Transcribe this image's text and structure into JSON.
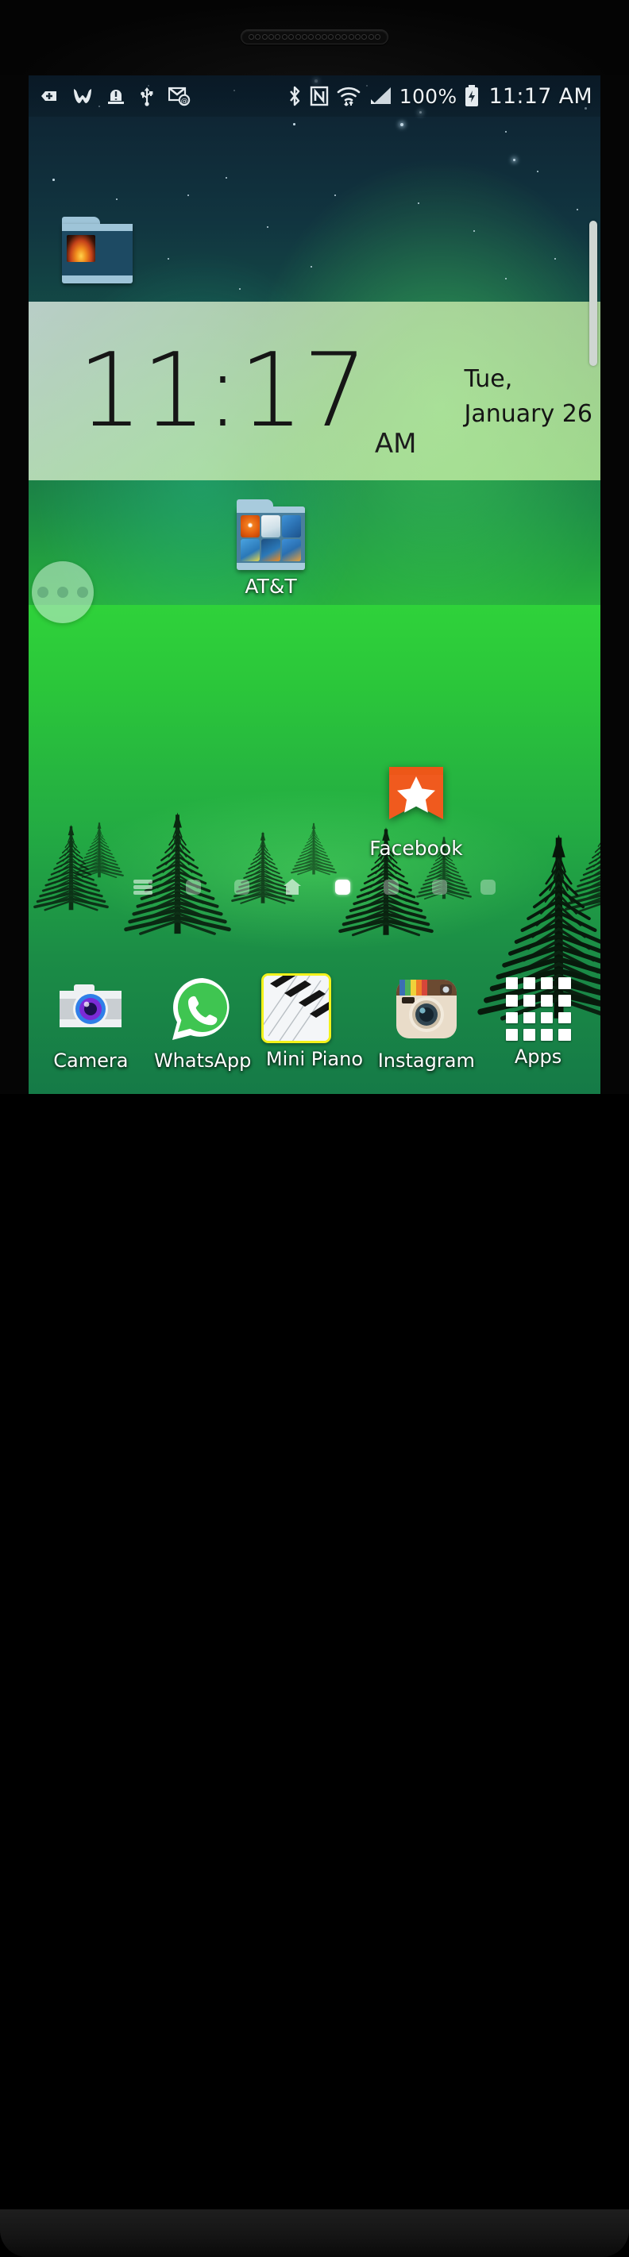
{
  "device": {
    "name": "android-phone",
    "earpiece_holes": 20
  },
  "status_bar": {
    "left_icons": [
      {
        "name": "medical-plus-icon",
        "glyph": "+"
      },
      {
        "name": "w-app-icon",
        "glyph": "W"
      },
      {
        "name": "alert-warning-icon",
        "glyph": "!"
      },
      {
        "name": "usb-icon",
        "glyph": "USB"
      },
      {
        "name": "email-at-icon",
        "glyph": "@"
      }
    ],
    "right_icons": [
      {
        "name": "bluetooth-icon",
        "glyph": "BT"
      },
      {
        "name": "nfc-icon",
        "glyph": "N"
      },
      {
        "name": "wifi-icon",
        "glyph": "WiFi"
      },
      {
        "name": "cellular-signal-icon",
        "glyph": "signal"
      },
      {
        "name": "battery-charging-icon",
        "glyph": "battery"
      }
    ],
    "battery_percent": "100%",
    "clock": "11:17 AM"
  },
  "clock_widget": {
    "time": "11:17",
    "ampm": "AM",
    "day": "Tue,",
    "date": "January 26"
  },
  "dark_folder": {
    "name": "music-folder",
    "label": "",
    "item_count": 1,
    "items": [
      {
        "name": "fire-album-art",
        "colors": [
          "#1a0d06",
          "#e8731a",
          "#f2b03c"
        ]
      }
    ]
  },
  "home_icons": [
    {
      "name": "att-folder",
      "label": "AT&T",
      "type": "folder",
      "items": [
        {
          "name": "att-globe-icon",
          "color": "#f06010"
        },
        {
          "name": "att-locker-icon",
          "color": "#e8eef2"
        },
        {
          "name": "att-navigator-icon",
          "color": "#2d7fc4"
        },
        {
          "name": "att-ready2go-icon",
          "color": "#2a6fb0"
        },
        {
          "name": "att-smart-wifi-icon",
          "color": "#1b4f80"
        },
        {
          "name": "att-mobile-icon",
          "color": "#2d85d8"
        }
      ]
    },
    {
      "name": "facebook-shortcut",
      "label": "Facebook",
      "type": "shortcut",
      "icon": "orange-ribbon-star-icon",
      "colors": {
        "ribbon": "#f05a1e",
        "star": "#ffffff"
      }
    }
  ],
  "page_indicator": {
    "total_pages": 7,
    "active_index": 4,
    "leading_icon": "list-hamburger-icon",
    "home_index": 3,
    "home_icon": "home-icon"
  },
  "dock": {
    "items": [
      {
        "name": "dock-camera",
        "label": "Camera",
        "icon": "camera-icon",
        "colors": {
          "body": "#d9dde0",
          "lens": "#5b2bd6",
          "ring": "#2f7fe8"
        }
      },
      {
        "name": "dock-whatsapp",
        "label": "WhatsApp",
        "icon": "whatsapp-icon",
        "colors": {
          "bubble": "#3fc551",
          "phone": "#ffffff"
        }
      },
      {
        "name": "dock-mini-piano",
        "label": "Mini Piano",
        "icon": "piano-keys-icon",
        "colors": {
          "border": "#f2f21a",
          "white_key": "#ffffff",
          "black_key": "#111111"
        }
      },
      {
        "name": "dock-instagram",
        "label": "Instagram",
        "icon": "instagram-retro-camera-icon",
        "colors": {
          "body": "#e9dcc9",
          "top": "#6b4a31",
          "lens": "#3a4a58"
        }
      },
      {
        "name": "dock-apps",
        "label": "Apps",
        "icon": "apps-grid-icon",
        "grid": {
          "rows": 4,
          "cols": 4
        },
        "color": "#ffffff"
      }
    ]
  },
  "floating_button": {
    "name": "overflow-menu-button",
    "dots": 3
  },
  "scrollbar": {
    "name": "page-scrollbar",
    "visible": true
  },
  "theme": {
    "wallpaper": "aurora-forest-night",
    "sky_top": "#0e2030",
    "aurora_green": "#2cc039",
    "ground_green": "#23ab43",
    "accent_yellow": "#f2f21a",
    "status_text": "#eef3f6"
  }
}
